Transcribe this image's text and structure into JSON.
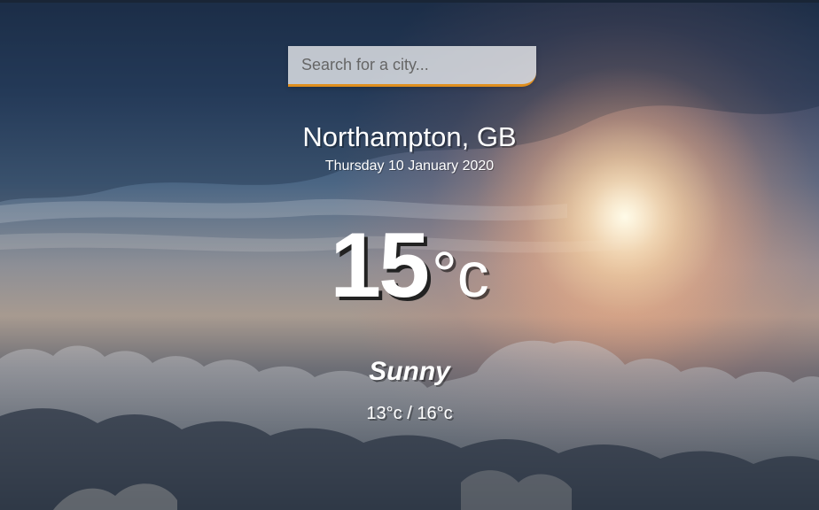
{
  "search": {
    "placeholder": "Search for a city..."
  },
  "location": {
    "city_country": "Northampton, GB",
    "date": "Thursday 10 January 2020"
  },
  "weather": {
    "temperature": "15",
    "unit": "°c",
    "condition": "Sunny",
    "range": "13°c / 16°c"
  },
  "colors": {
    "accent": "#df8e1d",
    "text": "#ffffff"
  }
}
